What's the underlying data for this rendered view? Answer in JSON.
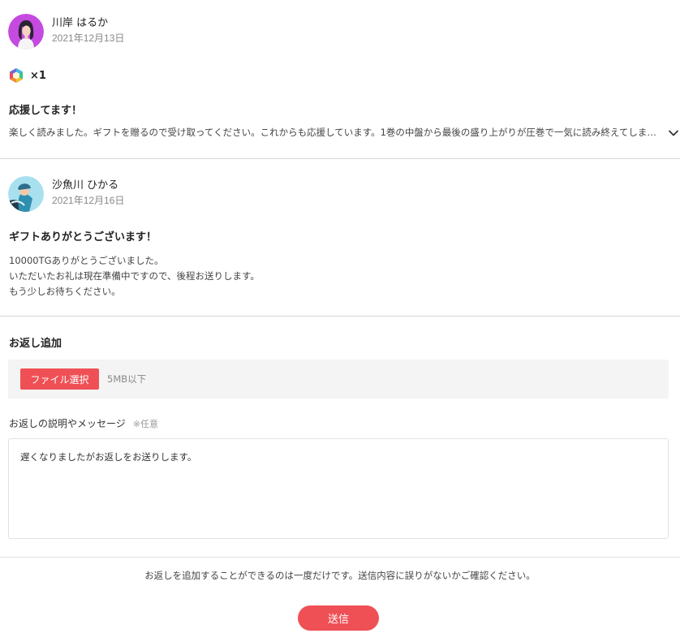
{
  "gift_message": {
    "user_name": "川岸 はるか",
    "date": "2021年12月13日",
    "gift_icon": "gem-icon",
    "gift_count": "×1",
    "title": "応援してます！",
    "body": "楽しく読みました。ギフトを贈るので受け取ってください。これからも応援しています。1巻の中盤から最後の盛り上がりが圧巻で一気に読み終えてしまいました。",
    "expand_icon": "chevron-down-icon"
  },
  "reply_message": {
    "user_name": "沙魚川 ひかる",
    "date": "2021年12月16日",
    "title": "ギフトありがとうございます！",
    "body_lines": [
      "10000TGありがとうございました。",
      "いただいたお礼は現在準備中ですので、後程お送りします。",
      "もう少しお待ちください。"
    ]
  },
  "return_form": {
    "section_title": "お返し追加",
    "file_button_label": "ファイル選択",
    "file_hint": "5MB以下",
    "description_label": "お返しの説明やメッセージ",
    "description_optional": "※任意",
    "description_value": "遅くなりましたがお返しをお送りします。",
    "notice": "お返しを追加することができるのは一度だけです。送信内容に誤りがないかご確認ください。",
    "submit_label": "送信"
  },
  "colors": {
    "accent": "#ef5055",
    "avatar1_bg": "#c44ae0",
    "avatar2_bg": "#a8e0f0"
  }
}
